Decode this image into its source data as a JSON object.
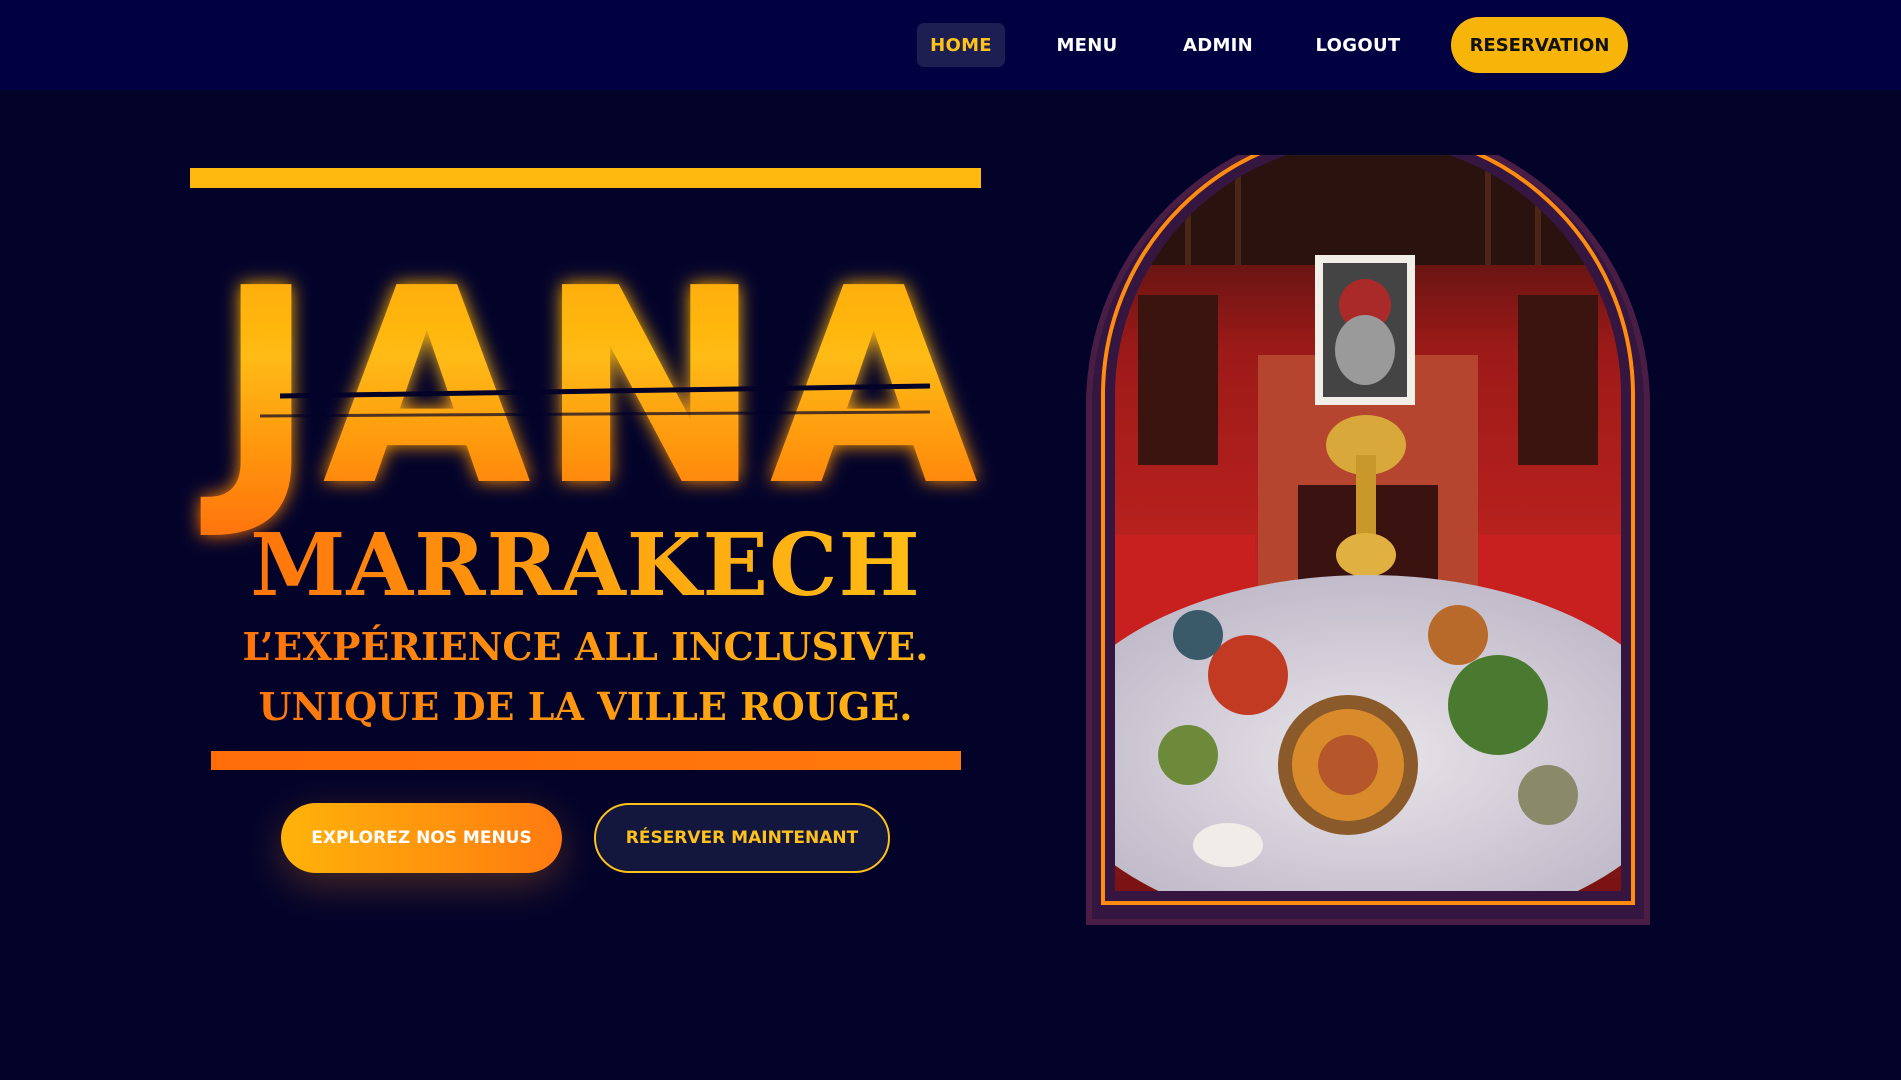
{
  "nav": {
    "items": [
      {
        "label": "HOME",
        "active": true
      },
      {
        "label": "MENU",
        "active": false
      },
      {
        "label": "ADMIN",
        "active": false
      },
      {
        "label": "LOGOUT",
        "active": false
      }
    ],
    "reservation_label": "RESERVATION"
  },
  "hero": {
    "logo_text": "JANA",
    "city": "MARRAKECH",
    "tagline_line1": "L’EXPÉRIENCE ALL INCLUSIVE.",
    "tagline_line2": "UNIQUE DE LA VILLE ROUGE.",
    "explore_label": "EXPLOREZ NOS MENUS",
    "reserve_label": "RÉSERVER MAINTENANT"
  },
  "colors": {
    "background": "#03032a",
    "navbar": "#010142",
    "accent_gold": "#ffb80d",
    "accent_orange": "#ff6d0a"
  },
  "icons": {
    "hero_image": "moroccan-feast-arch-image"
  }
}
